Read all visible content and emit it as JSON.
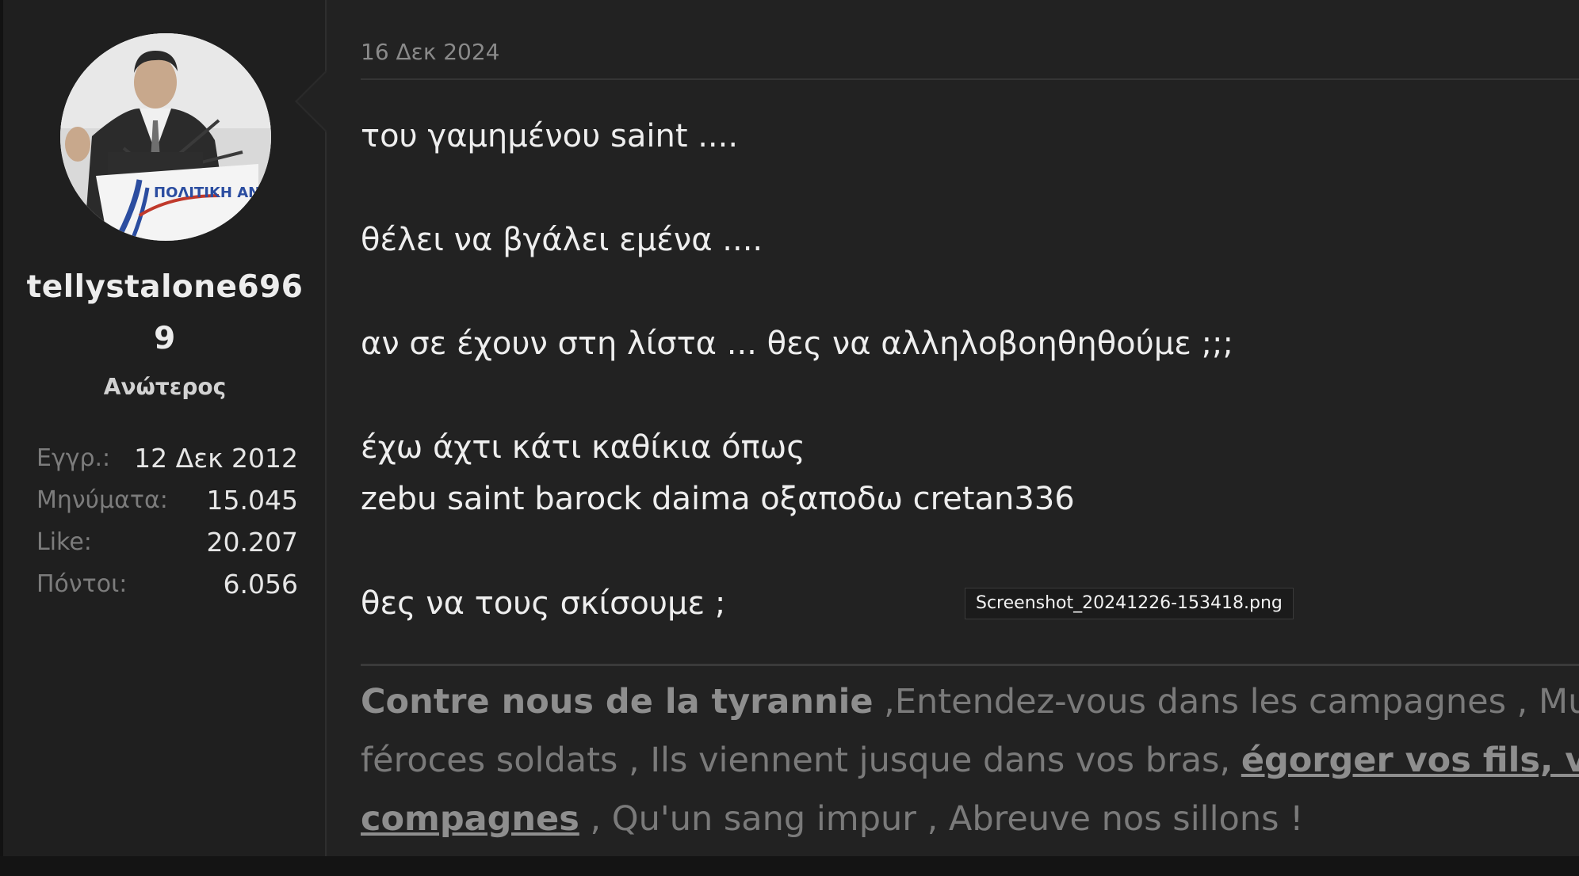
{
  "user": {
    "username_line1": "tellystalone696",
    "username_line2": "9",
    "title": "Ανώτερος",
    "avatar_caption": "ΠΟΛΙΤΙΚΗ ΑΝΟΙΞΗ",
    "stats": [
      {
        "label": "Εγγρ.:",
        "value": "12 Δεκ 2012"
      },
      {
        "label": "Μηνύματα:",
        "value": "15.045"
      },
      {
        "label": "Like:",
        "value": "20.207"
      },
      {
        "label": "Πόντοι:",
        "value": "6.056"
      }
    ]
  },
  "post": {
    "date": "16 Δεκ 2024",
    "lines": [
      "του γαμημένου saint ....",
      "θέλει να βγάλει εμένα ....",
      "αν σε έχουν στη λίστα ... θες να αλληλοβοηθηθούμε ;;;",
      "έχω άχτι κάτι καθίκια όπως",
      "zebu saint barock daima οξαποδω cretan336",
      "θες να τους σκίσουμε ;"
    ],
    "tooltip": "Screenshot_20241226-153418.png"
  },
  "signature": {
    "bold_start": "Contre nous de la tyrannie",
    "line1_rest": " ,Entendez-vous dans les campagnes , Mug",
    "line2_text": "féroces soldats , Ils viennent jusque dans vos bras, ",
    "line2_link": "égorger vos fils, vo",
    "line3_link": "compagnes",
    "line3_rest": " , Qu'un sang impur , Abreuve nos sillons !"
  }
}
